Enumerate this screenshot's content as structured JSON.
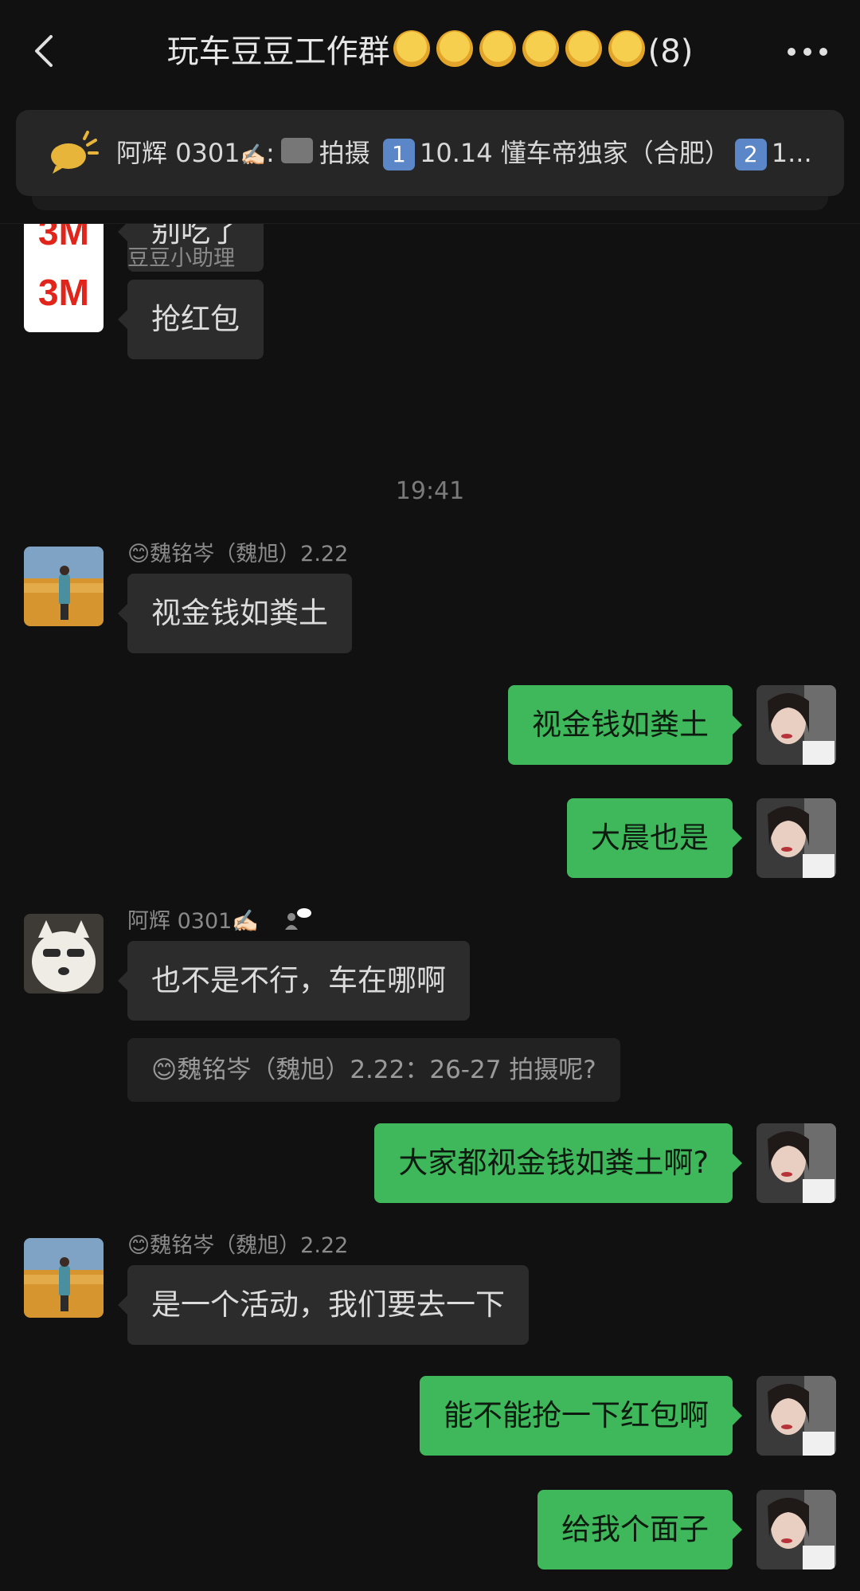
{
  "header": {
    "title_prefix": "玩车豆豆工作群",
    "title_count": "(8)",
    "title_sun_count": 6
  },
  "announcement": {
    "sender": "阿辉 0301",
    "sep": ":",
    "text1": "拍摄",
    "key1": "1",
    "text2": "10.14 懂车帝独家（合肥）",
    "key2": "2",
    "text3": "1..."
  },
  "messages": [
    {
      "dir": "in",
      "avatar": "3m-logo",
      "text": "别吃了"
    },
    {
      "dir": "in",
      "avatar": "3m-logo",
      "sender": "豆豆小助理",
      "text": "抢红包"
    },
    {
      "type": "time",
      "text": "19:41"
    },
    {
      "dir": "in",
      "avatar": "landscape",
      "sender": "😊魏铭岑（魏旭）2.22",
      "text": "视金钱如粪土"
    },
    {
      "dir": "out",
      "avatar": "portrait",
      "text": "视金钱如粪土"
    },
    {
      "dir": "out",
      "avatar": "portrait",
      "text": "大晨也是"
    },
    {
      "dir": "in",
      "avatar": "dog",
      "sender": "阿辉 0301✍🏻",
      "text": "也不是不行，车在哪啊",
      "quote": "😊魏铭岑（魏旭）2.22：26-27 拍摄呢?"
    },
    {
      "dir": "out",
      "avatar": "portrait",
      "text": "大家都视金钱如粪土啊?"
    },
    {
      "dir": "in",
      "avatar": "landscape",
      "sender": "😊魏铭岑（魏旭）2.22",
      "text": "是一个活动，我们要去一下"
    },
    {
      "dir": "out",
      "avatar": "portrait",
      "text": "能不能抢一下红包啊"
    },
    {
      "dir": "out",
      "avatar": "portrait",
      "text": "给我个面子"
    }
  ]
}
